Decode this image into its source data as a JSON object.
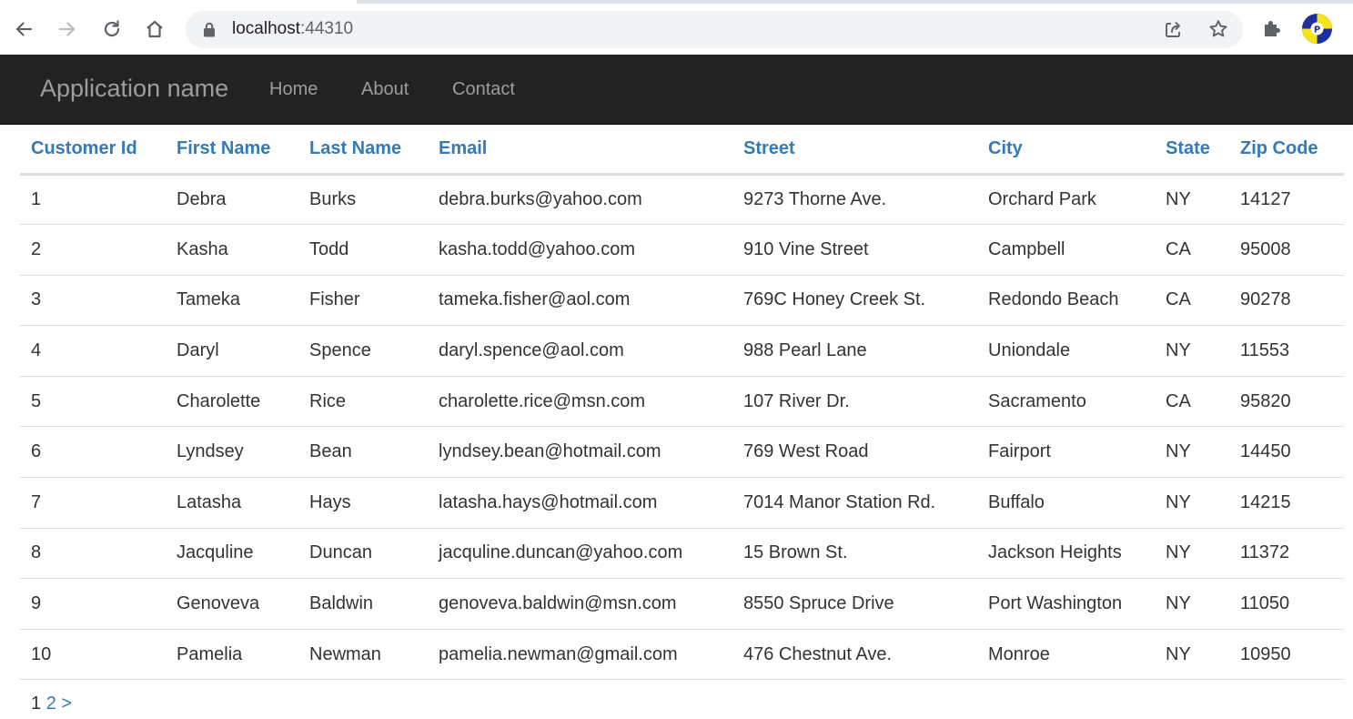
{
  "browser": {
    "url_host": "localhost",
    "url_port": ":44310"
  },
  "navbar": {
    "brand": "Application name",
    "links": [
      "Home",
      "About",
      "Contact"
    ]
  },
  "table": {
    "headers": [
      "Customer Id",
      "First Name",
      "Last Name",
      "Email",
      "Street",
      "City",
      "State",
      "Zip Code"
    ],
    "rows": [
      [
        "1",
        "Debra",
        "Burks",
        "debra.burks@yahoo.com",
        "9273 Thorne Ave.",
        "Orchard Park",
        "NY",
        "14127"
      ],
      [
        "2",
        "Kasha",
        "Todd",
        "kasha.todd@yahoo.com",
        "910 Vine Street",
        "Campbell",
        "CA",
        "95008"
      ],
      [
        "3",
        "Tameka",
        "Fisher",
        "tameka.fisher@aol.com",
        "769C Honey Creek St.",
        "Redondo Beach",
        "CA",
        "90278"
      ],
      [
        "4",
        "Daryl",
        "Spence",
        "daryl.spence@aol.com",
        "988 Pearl Lane",
        "Uniondale",
        "NY",
        "11553"
      ],
      [
        "5",
        "Charolette",
        "Rice",
        "charolette.rice@msn.com",
        "107 River Dr.",
        "Sacramento",
        "CA",
        "95820"
      ],
      [
        "6",
        "Lyndsey",
        "Bean",
        "lyndsey.bean@hotmail.com",
        "769 West Road",
        "Fairport",
        "NY",
        "14450"
      ],
      [
        "7",
        "Latasha",
        "Hays",
        "latasha.hays@hotmail.com",
        "7014 Manor Station Rd.",
        "Buffalo",
        "NY",
        "14215"
      ],
      [
        "8",
        "Jacquline",
        "Duncan",
        "jacquline.duncan@yahoo.com",
        "15 Brown St.",
        "Jackson Heights",
        "NY",
        "11372"
      ],
      [
        "9",
        "Genoveva",
        "Baldwin",
        "genoveva.baldwin@msn.com",
        "8550 Spruce Drive",
        "Port Washington",
        "NY",
        "11050"
      ],
      [
        "10",
        "Pamelia",
        "Newman",
        "pamelia.newman@gmail.com",
        "476 Chestnut Ave.",
        "Monroe",
        "NY",
        "10950"
      ]
    ]
  },
  "pager": {
    "current": "1",
    "next_page": "2",
    "next_arrow": ">"
  },
  "colors": {
    "navbar_bg": "#222222",
    "link": "#337ab7",
    "nav_text": "#9d9d9d"
  },
  "icons": [
    "back-icon",
    "forward-icon",
    "reload-icon",
    "home-icon",
    "lock-icon",
    "share-icon",
    "star-icon",
    "extensions-icon",
    "profile-avatar"
  ]
}
